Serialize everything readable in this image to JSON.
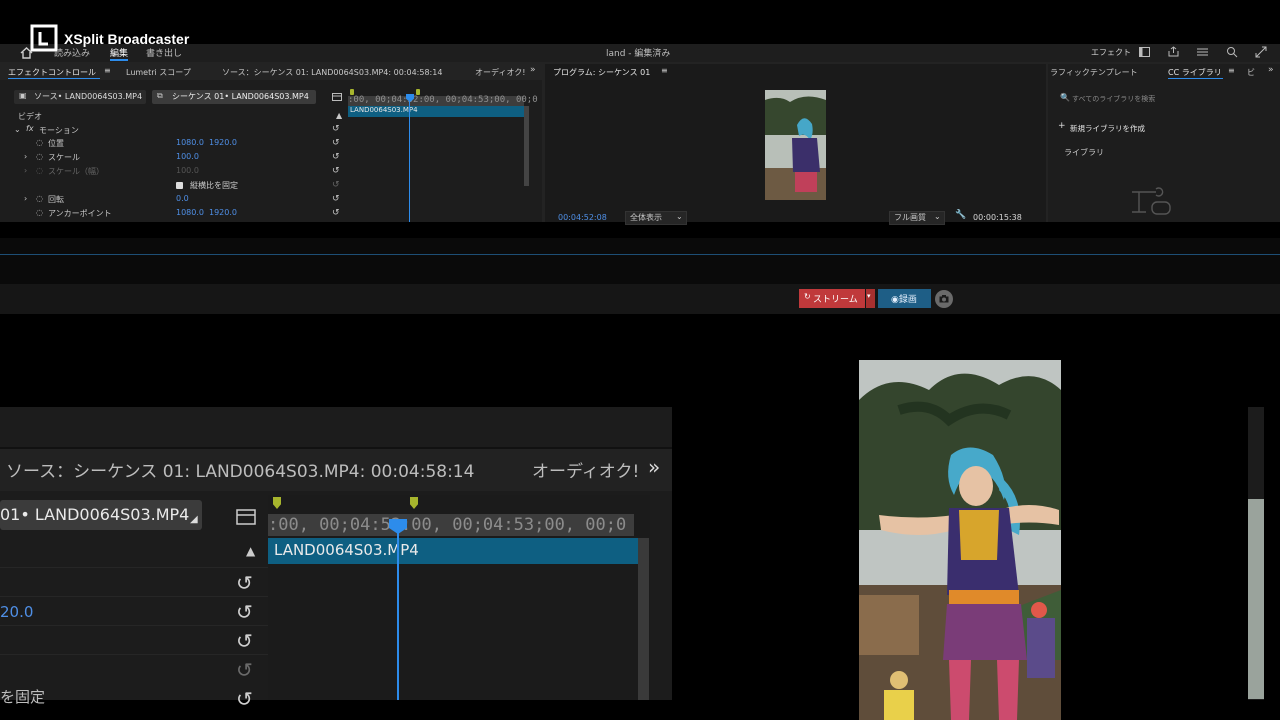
{
  "xsplit": {
    "title": "XSplit Broadcaster",
    "stream_label": "ストリーム",
    "record_label": "◉録画"
  },
  "premiere": {
    "menu": [
      "読み込み",
      "編集",
      "書き出し"
    ],
    "project_title": "land - 編集済み",
    "workspace_label": "エフェクト",
    "tabs_left": [
      "エフェクトコントロール",
      "Lumetri スコープ",
      "ソース：シーケンス 01: LAND0064S03.MP4: 00:04:58:14",
      "オーディオク!"
    ],
    "source_tab": "ソース• LAND0064S03.MP4",
    "sequence_tab": "シーケンス 01• LAND0064S03.MP4",
    "ruler_text": ":00, 00;04:52:00, 00;04:53;00, 00;0",
    "clip_name": "LAND0064S03.MP4",
    "video_label": "ビデオ",
    "motion_label": "モーション",
    "props": [
      {
        "name": "位置",
        "v1": "1080.0",
        "v2": "1920.0",
        "expand": false,
        "dim": false
      },
      {
        "name": "スケール",
        "v1": "100.0",
        "v2": "",
        "expand": true,
        "dim": false
      },
      {
        "name": "スケール（幅）",
        "v1": "100.0",
        "v2": "",
        "expand": true,
        "dim": true
      },
      {
        "name": "",
        "v1": "",
        "v2": "",
        "expand": false,
        "dim": false
      },
      {
        "name": "回転",
        "v1": "0.0",
        "v2": "",
        "expand": true,
        "dim": false
      },
      {
        "name": "アンカーポイント",
        "v1": "1080.0",
        "v2": "1920.0",
        "expand": false,
        "dim": false
      }
    ],
    "aspect_lock_label": "縦横比を固定",
    "program_title": "プログラム: シーケンス 01",
    "program_timecode": "00:04:52:08",
    "fit_label": "全体表示",
    "quality_label": "フル画質",
    "duration": "00:00:15:38",
    "library_tabs": [
      "ラフィックテンプレート",
      "CC ライブラリ",
      "ビ"
    ],
    "library_search_placeholder": "すべてのライブラリを検索",
    "new_library": "新規ライブラリを作成",
    "library_label": "ライブラリ"
  },
  "zoom": {
    "source_tab": "ソース：シーケンス 01: LAND0064S03.MP4: 00:04:58:14",
    "audio_tab": "オーディオク!",
    "sequence_tab": "01• LAND0064S03.MP4",
    "ruler_text": ":00, 00;04:52:00, 00;04:53;00, 00;0",
    "clip_name": "LAND0064S03.MP4",
    "value": "20.0",
    "aspect_partial": "を固定"
  },
  "colors": {
    "accent_blue": "#2d8ceb",
    "clip_blue": "#0e5f82",
    "stream_red": "#c0393b",
    "record_blue": "#1e5e86"
  }
}
